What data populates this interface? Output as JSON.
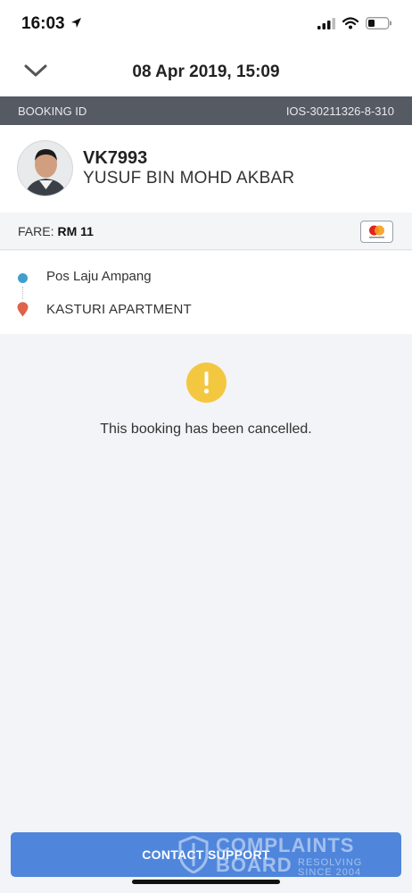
{
  "status_bar": {
    "time": "16:03"
  },
  "header": {
    "title": "08 Apr 2019, 15:09"
  },
  "booking": {
    "label": "BOOKING ID",
    "id": "IOS-30211326-8-310"
  },
  "driver": {
    "plate": "VK7993",
    "name": "YUSUF BIN MOHD AKBAR"
  },
  "fare": {
    "label": "FARE:",
    "value": "RM 11",
    "card_brand": "mastercard"
  },
  "route": {
    "pickup": "Pos Laju Ampang",
    "dropoff": "KASTURI APARTMENT"
  },
  "notice": {
    "message": "This booking has been cancelled."
  },
  "actions": {
    "contact_support": "CONTACT SUPPORT"
  },
  "watermark": {
    "line1": "COMPLAINTS",
    "line2": "BOARD",
    "side1": "RESOLVING",
    "side2": "SINCE 2004"
  },
  "colors": {
    "booking_bar": "#555a63",
    "button": "#4f86dc",
    "pickup": "#3fa0cf",
    "dropoff": "#e0624a",
    "alert": "#f4c741"
  },
  "icons": {
    "back": "chevron-down-icon",
    "location_arrow": "location-arrow-icon",
    "signal": "signal-icon",
    "wifi": "wifi-icon",
    "battery": "battery-icon",
    "alert": "exclamation-icon",
    "card": "mastercard-icon"
  }
}
